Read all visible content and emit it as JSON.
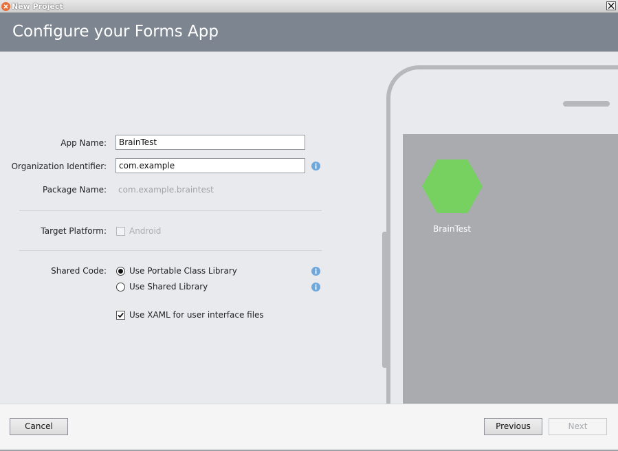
{
  "window": {
    "title": "New Project"
  },
  "header": {
    "title": "Configure your Forms App"
  },
  "form": {
    "app_name": {
      "label": "App Name:",
      "value": "BrainTest"
    },
    "org_identifier": {
      "label": "Organization Identifier:",
      "value": "com.example"
    },
    "package_name": {
      "label": "Package Name:",
      "value": "com.example.braintest"
    },
    "target_platform": {
      "label": "Target Platform:",
      "option": "Android",
      "checked": false,
      "enabled": false
    },
    "shared_code": {
      "label": "Shared Code:",
      "options": [
        {
          "label": "Use Portable Class Library",
          "selected": true
        },
        {
          "label": "Use Shared Library",
          "selected": false
        }
      ]
    },
    "xaml": {
      "label": "Use XAML for user interface files",
      "checked": true
    }
  },
  "preview": {
    "app_label": "BrainTest",
    "icon_color": "#76d160"
  },
  "footer": {
    "cancel_label": "Cancel",
    "previous_label": "Previous",
    "next_label": "Next"
  },
  "colors": {
    "header_bg": "#7d8690",
    "info_icon": "#6fa8dc",
    "content_bg": "#e8eaee"
  }
}
